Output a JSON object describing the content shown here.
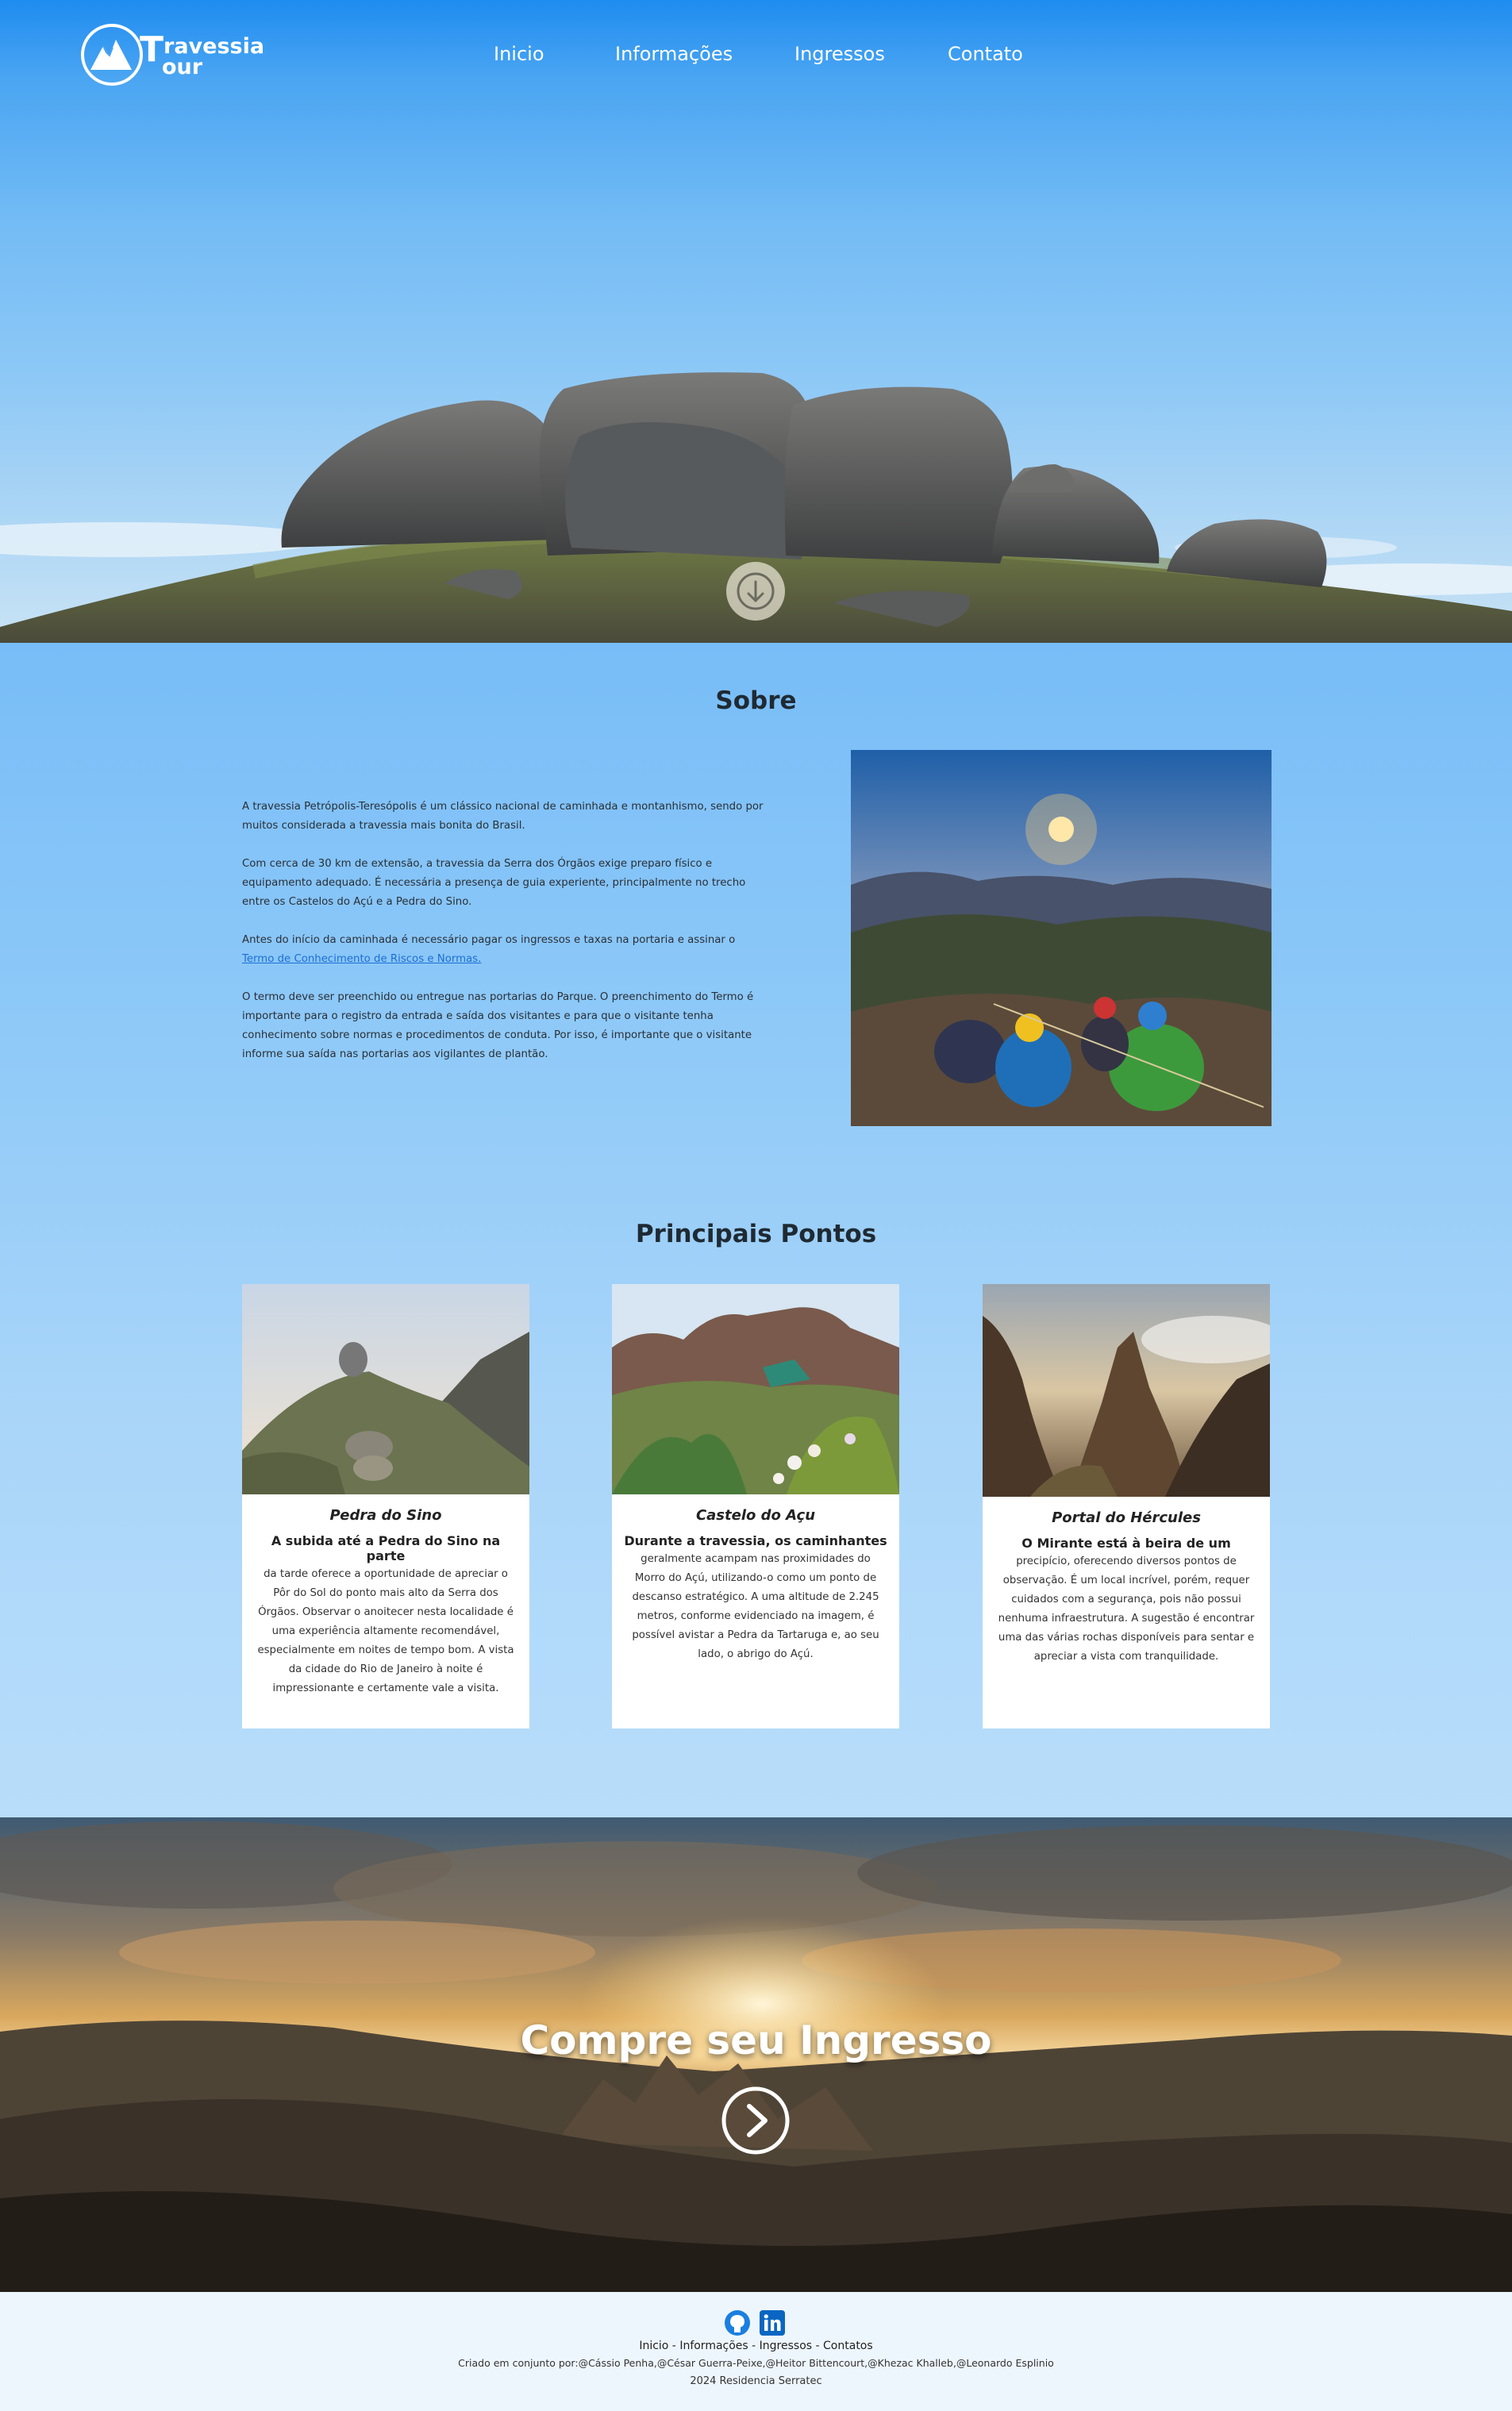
{
  "header": {
    "logo_line1": "ravessia",
    "logo_line2": "our",
    "nav": [
      "Inicio",
      "Informações",
      "Ingressos",
      "Contato"
    ]
  },
  "sobre": {
    "title": "Sobre",
    "p1": "A travessia Petrópolis-Teresópolis é um clássico nacional de caminhada e montanhismo, sendo por muitos considerada a travessia mais bonita do Brasil.",
    "p2": "Com cerca de 30 km de extensão, a travessia da Serra dos Órgãos exige preparo físico e equipamento adequado. É necessária a presença de guia experiente, principalmente no trecho entre os Castelos do Açú e a Pedra do Sino.",
    "p3_before": "Antes do início da caminhada é necessário pagar os ingressos e taxas na portaria e assinar o ",
    "p3_link": "Termo de Conhecimento de Riscos e Normas.",
    "p4": "O termo deve ser preenchido ou entregue nas portarias do Parque. O preenchimento do Termo é importante para o registro da entrada e saída dos visitantes e para que o visitante tenha conhecimento sobre normas e procedimentos de conduta. Por isso, é importante que o visitante informe sua saída nas portarias aos vigilantes de plantão."
  },
  "pontos": {
    "title": "Principais Pontos",
    "cards": [
      {
        "title": "Pedra do Sino",
        "lead": "A subida até a Pedra do Sino na parte",
        "body": "da tarde oferece a oportunidade de apreciar o Pôr do Sol do ponto mais alto da Serra dos Órgãos. Observar o anoitecer nesta localidade é uma experiência altamente recomendável, especialmente em noites de tempo bom. A vista da cidade do Rio de Janeiro à noite é impressionante e certamente vale a visita."
      },
      {
        "title": "Castelo do Açu",
        "lead": "Durante a travessia, os caminhantes",
        "body": "geralmente acampam nas proximidades do Morro do Açú, utilizando-o como um ponto de descanso estratégico. A uma altitude de 2.245 metros, conforme evidenciado na imagem, é possível avistar a Pedra da Tartaruga e, ao seu lado, o abrigo do Açú."
      },
      {
        "title": "Portal do Hércules",
        "lead": "O Mirante está à beira de um",
        "body": "precipício, oferecendo diversos pontos de observação. É um local incrível, porém, requer cuidados com a segurança, pois não possui nenhuma infraestrutura. A sugestão é encontrar uma das várias rochas disponíveis para sentar e apreciar a vista com tranquilidade."
      }
    ]
  },
  "cta": {
    "title": "Compre seu Ingresso"
  },
  "footer": {
    "links": [
      "Inicio",
      "Informações",
      "Ingressos",
      "Contatos"
    ],
    "separator": " - ",
    "credits": "Criado em conjunto por:@Cássio Penha,@César Guerra-Peixe,@Heitor Bittencourt,@Khezac Khalleb,@Leonardo Esplinio",
    "year": "2024 Residencia Serratec"
  },
  "colors": {
    "sky_top": "#1e8cf0",
    "main_bg": "#8cc8f8",
    "link": "#1d6fd6",
    "footer_bg": "#eef6fd",
    "linkedin": "#0a66c2",
    "github": "#1a7fe0"
  },
  "icons": [
    "mountain-logo-icon",
    "arrow-down-icon",
    "chevron-right-circle-icon",
    "github-icon",
    "linkedin-icon"
  ]
}
